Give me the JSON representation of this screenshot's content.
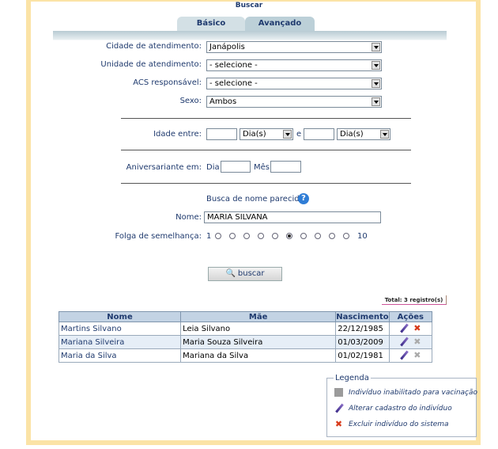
{
  "header": {
    "title": "Buscar"
  },
  "tabs": [
    {
      "label": "Básico",
      "active": false
    },
    {
      "label": "Avançado",
      "active": true
    }
  ],
  "form": {
    "cidade": {
      "label": "Cidade de atendimento:",
      "value": "Janápolis"
    },
    "unidade": {
      "label": "Unidade de atendimento:",
      "value": "- selecione -"
    },
    "acs": {
      "label": "ACS responsável:",
      "value": "- selecione -"
    },
    "sexo": {
      "label": "Sexo:",
      "value": "Ambos"
    },
    "idade": {
      "label": "Idade entre:",
      "from_value": "",
      "from_unit": "Dia(s)",
      "sep": "e",
      "to_value": "",
      "to_unit": "Dia(s)"
    },
    "aniversario": {
      "label": "Aniversariante em:",
      "dia_label": "Dia",
      "dia_value": "",
      "mes_label": "Mês",
      "mes_value": ""
    },
    "busca_parecido": {
      "label": "Busca de nome parecido",
      "help_icon": "?"
    },
    "nome": {
      "label": "Nome:",
      "value": "MARIA SILVANA"
    },
    "folga": {
      "label": "Folga de semelhança:",
      "min": "1",
      "max": "10",
      "selected": 6,
      "count": 10
    },
    "search_button": "buscar"
  },
  "results": {
    "total": "Total: 3 registro(s)",
    "columns": [
      "Nome",
      "Mãe",
      "Nascimento",
      "Ações"
    ],
    "rows": [
      {
        "nome": "Martins Silvano",
        "mae": "Leia Silvano",
        "nascimento": "22/12/1985",
        "delete_enabled": true
      },
      {
        "nome": "Mariana Silveira",
        "mae": "Maria Souza Silveira",
        "nascimento": "01/03/2009",
        "delete_enabled": false
      },
      {
        "nome": "Maria da Silva",
        "mae": "Mariana da Silva",
        "nascimento": "01/02/1981",
        "delete_enabled": false
      }
    ]
  },
  "legend": {
    "title": "Legenda",
    "items": [
      {
        "icon": "grey-square-icon",
        "text": "Indivíduo inabilitado para vacinação"
      },
      {
        "icon": "pencil-icon",
        "text": "Alterar cadastro do indivíduo"
      },
      {
        "icon": "delete-x-icon",
        "text": "Excluir indivíduo do sistema"
      }
    ]
  },
  "colors": {
    "frame": "#fbe3a6",
    "tab": "#c5d6de",
    "header_row": "#c3d3e4",
    "delete": "#d83a1a"
  }
}
